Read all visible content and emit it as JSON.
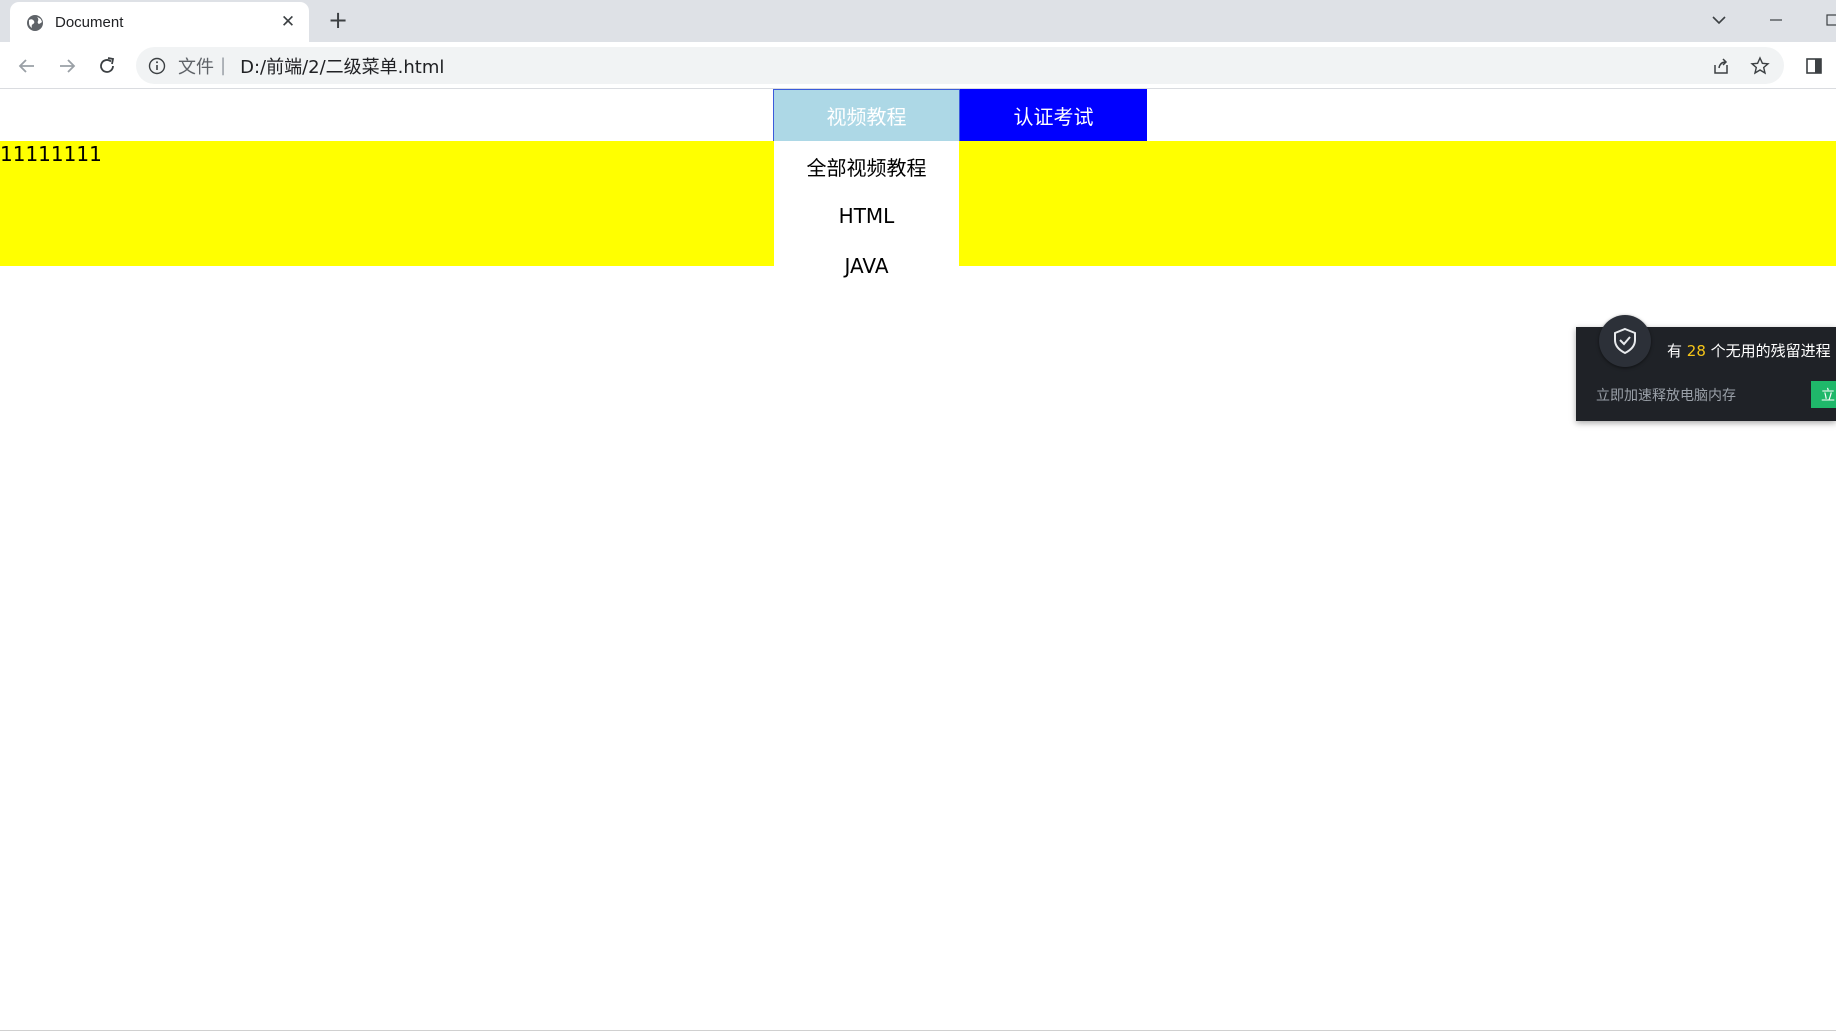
{
  "browser": {
    "tab_title": "Document",
    "new_tab_symbol": "+",
    "close_symbol": "✕",
    "address_scheme": "文件",
    "address_separator": "|",
    "address_url": "D:/前端/2/二级菜单.html"
  },
  "page": {
    "menu": {
      "video_label": "视频教程",
      "cert_label": "认证考试",
      "submenu_items": [
        "全部视频教程",
        "HTML",
        "JAVA"
      ]
    },
    "content_text": "11111111"
  },
  "popup": {
    "message_prefix": "有 ",
    "message_count": "28",
    "message_suffix": " 个无用的残留进程",
    "subtext": "立即加速释放电脑内存",
    "action_label": "立"
  },
  "colors": {
    "content_bg": "#ffff00",
    "menu_video_bg": "#add8e6",
    "menu_cert_bg": "#0000ff",
    "popup_bg": "#1f2227",
    "popup_count": "#f5c518",
    "popup_action": "#1fb86a"
  }
}
